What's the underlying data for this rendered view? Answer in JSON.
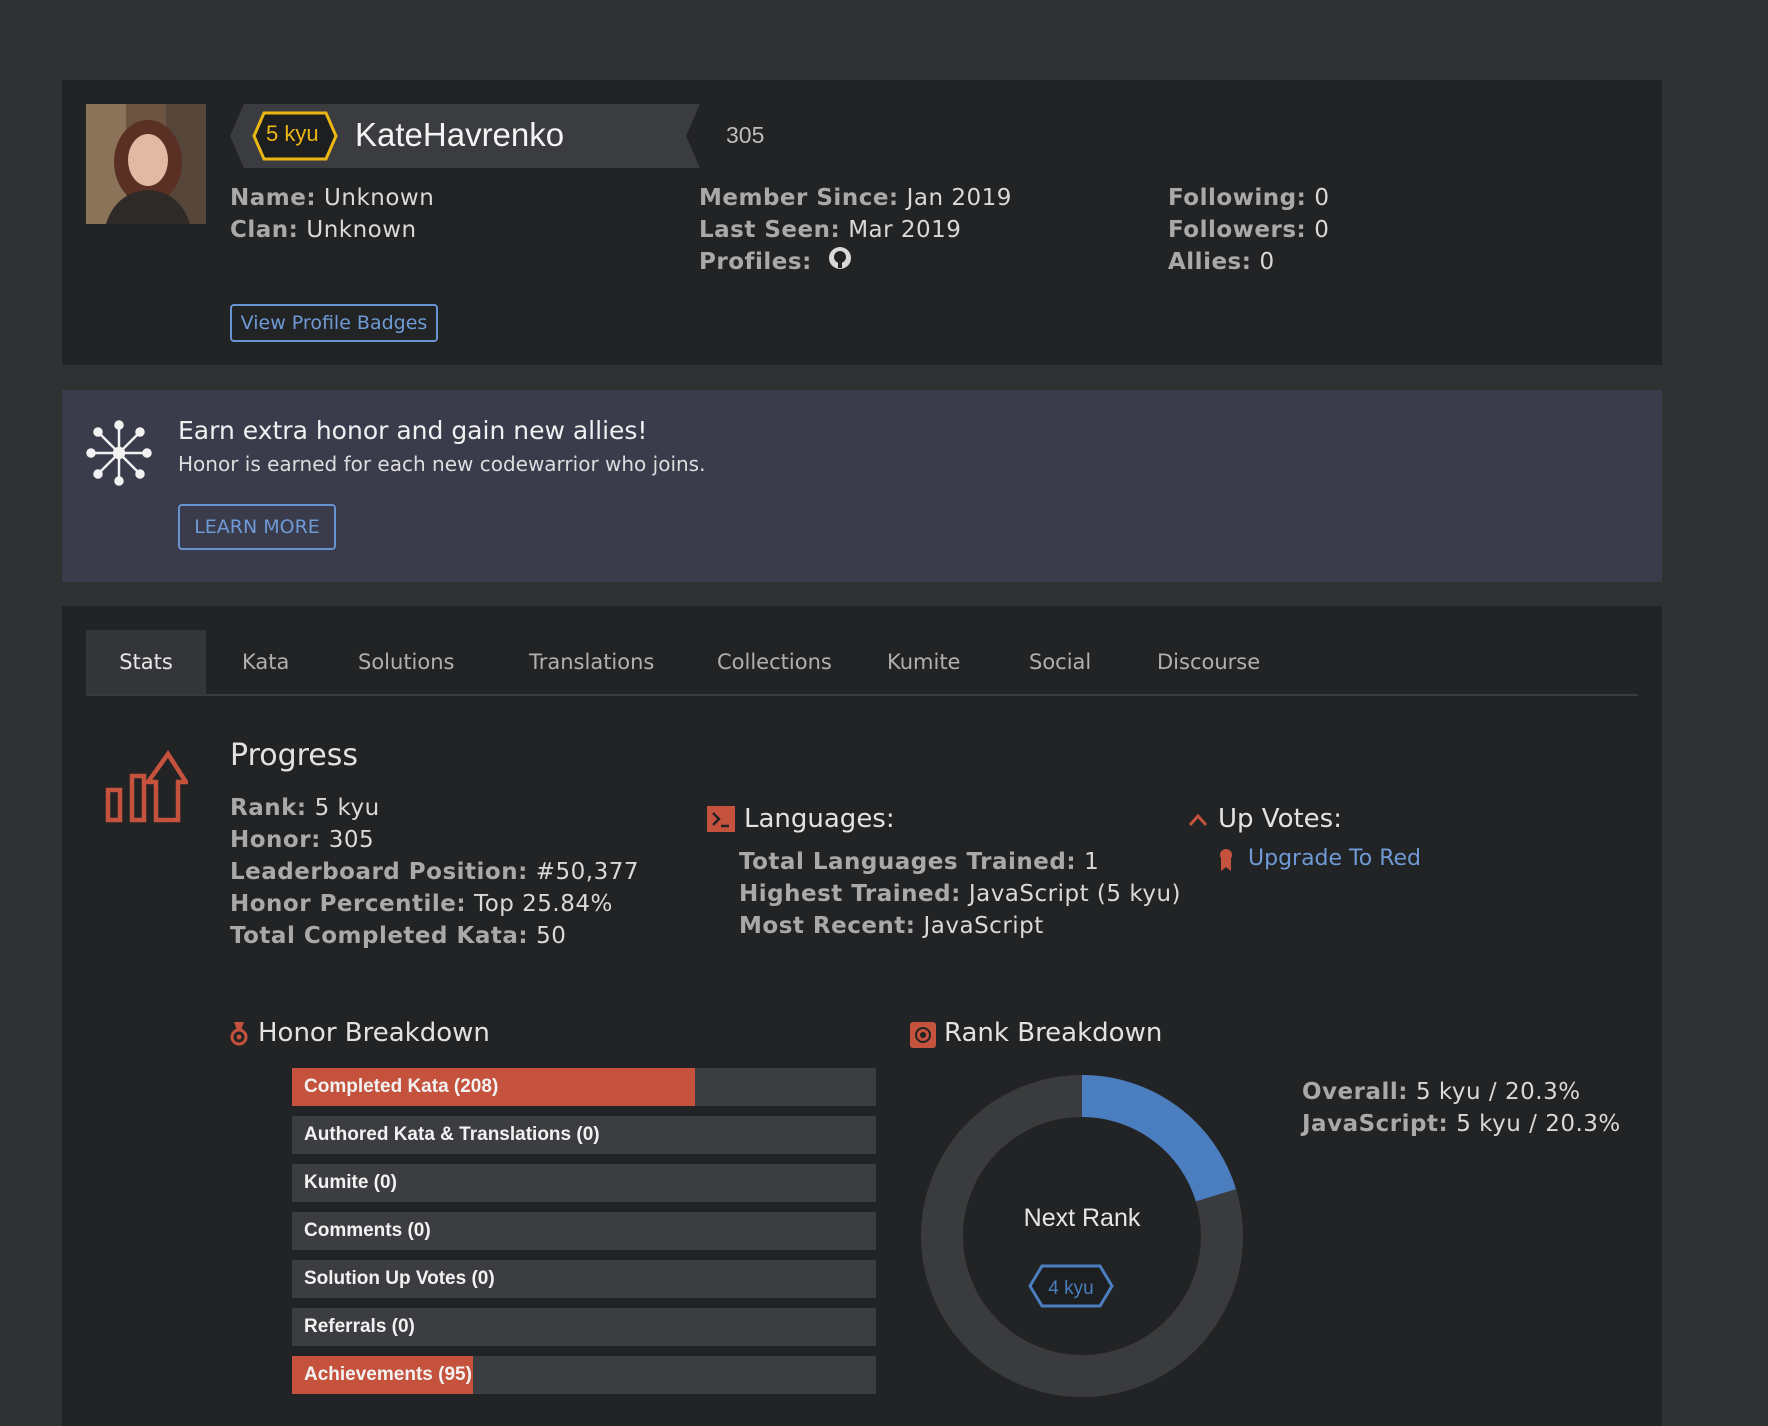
{
  "colors": {
    "accent_red": "#c4523c",
    "link_blue": "#6794d1",
    "rank_yellow": "#ecb613",
    "donut_blue": "#4a7ebf"
  },
  "profile": {
    "rank_badge": "5 kyu",
    "username": "KateHavrenko",
    "honor": "305",
    "name_label": "Name:",
    "name_value": "Unknown",
    "clan_label": "Clan:",
    "clan_value": "Unknown",
    "member_since_label": "Member Since:",
    "member_since_value": "Jan 2019",
    "last_seen_label": "Last Seen:",
    "last_seen_value": "Mar 2019",
    "profiles_label": "Profiles:",
    "following_label": "Following:",
    "following_value": "0",
    "followers_label": "Followers:",
    "followers_value": "0",
    "allies_label": "Allies:",
    "allies_value": "0",
    "view_badges_button": "View Profile Badges"
  },
  "promo": {
    "headline": "Earn extra honor and gain new allies!",
    "subtext": "Honor is earned for each new codewarrior who joins.",
    "learn_more_button": "LEARN MORE"
  },
  "tabs": [
    "Stats",
    "Kata",
    "Solutions",
    "Translations",
    "Collections",
    "Kumite",
    "Social",
    "Discourse"
  ],
  "progress": {
    "title": "Progress",
    "rank_label": "Rank:",
    "rank_value": "5 kyu",
    "honor_label": "Honor:",
    "honor_value": "305",
    "leaderboard_label": "Leaderboard Position:",
    "leaderboard_value": "#50,377",
    "percentile_label": "Honor Percentile:",
    "percentile_value": "Top 25.84%",
    "completed_label": "Total Completed Kata:",
    "completed_value": "50"
  },
  "languages": {
    "title": "Languages:",
    "total_label": "Total Languages Trained:",
    "total_value": "1",
    "highest_label": "Highest Trained:",
    "highest_value": "JavaScript (5 kyu)",
    "recent_label": "Most Recent:",
    "recent_value": "JavaScript"
  },
  "upvotes": {
    "title": "Up Votes:",
    "link": "Upgrade To Red"
  },
  "honor_breakdown": {
    "title": "Honor Breakdown",
    "items": [
      {
        "label": "Completed Kata (208)",
        "fill": 0.69
      },
      {
        "label": "Authored Kata & Translations (0)",
        "fill": 0
      },
      {
        "label": "Kumite (0)",
        "fill": 0
      },
      {
        "label": "Comments (0)",
        "fill": 0
      },
      {
        "label": "Solution Up Votes (0)",
        "fill": 0
      },
      {
        "label": "Referrals (0)",
        "fill": 0
      },
      {
        "label": "Achievements (95)",
        "fill": 0.31
      }
    ]
  },
  "rank_breakdown": {
    "title": "Rank Breakdown",
    "center_label": "Next Rank",
    "next_rank": "4 kyu",
    "progress_fraction": 0.203,
    "overall_label": "Overall:",
    "overall_value": "5 kyu / 20.3%",
    "javascript_label": "JavaScript:",
    "javascript_value": "5 kyu / 20.3%"
  }
}
